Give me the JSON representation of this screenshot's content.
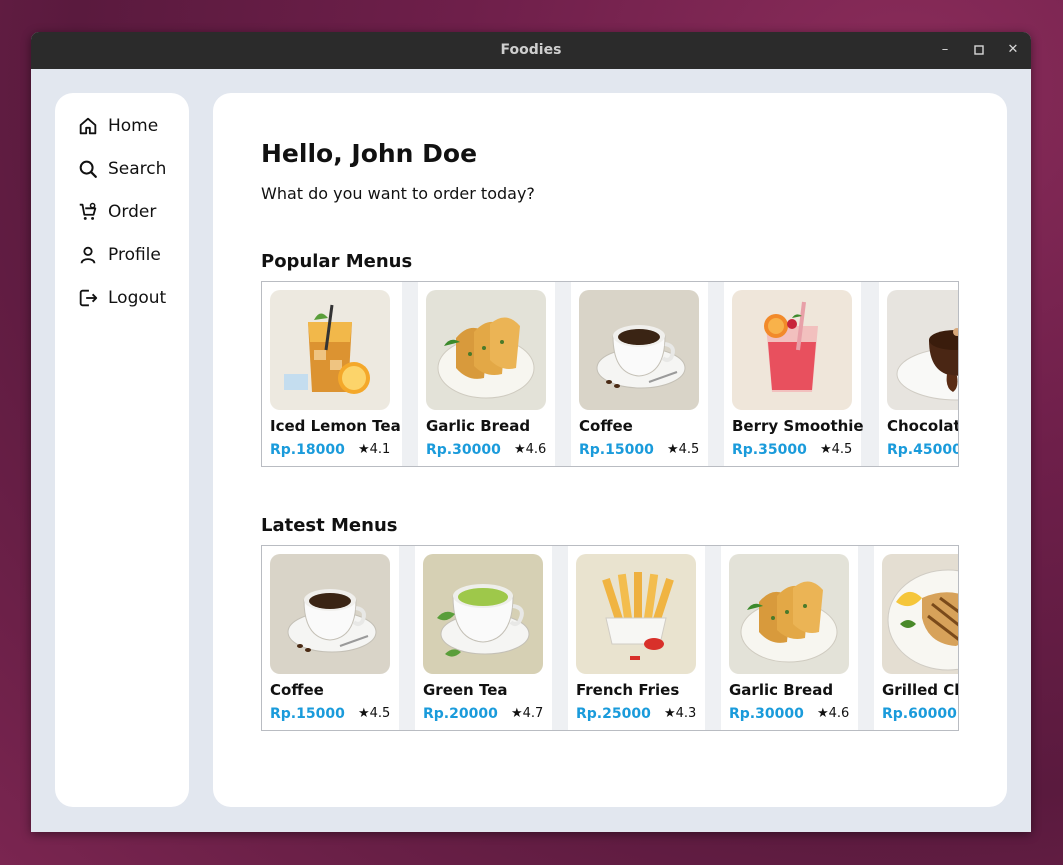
{
  "window": {
    "title": "Foodies"
  },
  "nav": {
    "items": [
      {
        "label": "Home",
        "icon": "home-icon"
      },
      {
        "label": "Search",
        "icon": "search-icon"
      },
      {
        "label": "Order",
        "icon": "cart-icon"
      },
      {
        "label": "Profile",
        "icon": "user-icon"
      },
      {
        "label": "Logout",
        "icon": "logout-icon"
      }
    ]
  },
  "main": {
    "greeting": "Hello, John Doe",
    "subtitle": "What do you want to order today?",
    "popular": {
      "title": "Popular Menus",
      "items": [
        {
          "name": "Iced Lemon Tea",
          "price": "Rp.18000",
          "rating": "★4.1"
        },
        {
          "name": "Garlic Bread",
          "price": "Rp.30000",
          "rating": "★4.6"
        },
        {
          "name": "Coffee",
          "price": "Rp.15000",
          "rating": "★4.5"
        },
        {
          "name": "Berry Smoothie",
          "price": "Rp.35000",
          "rating": "★4.5"
        },
        {
          "name": "Chocolate",
          "price": "Rp.45000",
          "rating": ""
        }
      ]
    },
    "latest": {
      "title": "Latest Menus",
      "items": [
        {
          "name": "Coffee",
          "price": "Rp.15000",
          "rating": "★4.5"
        },
        {
          "name": "Green Tea",
          "price": "Rp.20000",
          "rating": "★4.7"
        },
        {
          "name": "French Fries",
          "price": "Rp.25000",
          "rating": "★4.3"
        },
        {
          "name": "Garlic Bread",
          "price": "Rp.30000",
          "rating": "★4.6"
        },
        {
          "name": "Grilled Ch",
          "price": "Rp.60000",
          "rating": ""
        }
      ]
    }
  },
  "colors": {
    "price": "#1a9bdb",
    "background": "#e2e7ef",
    "titlebar": "#2b2b2b"
  }
}
